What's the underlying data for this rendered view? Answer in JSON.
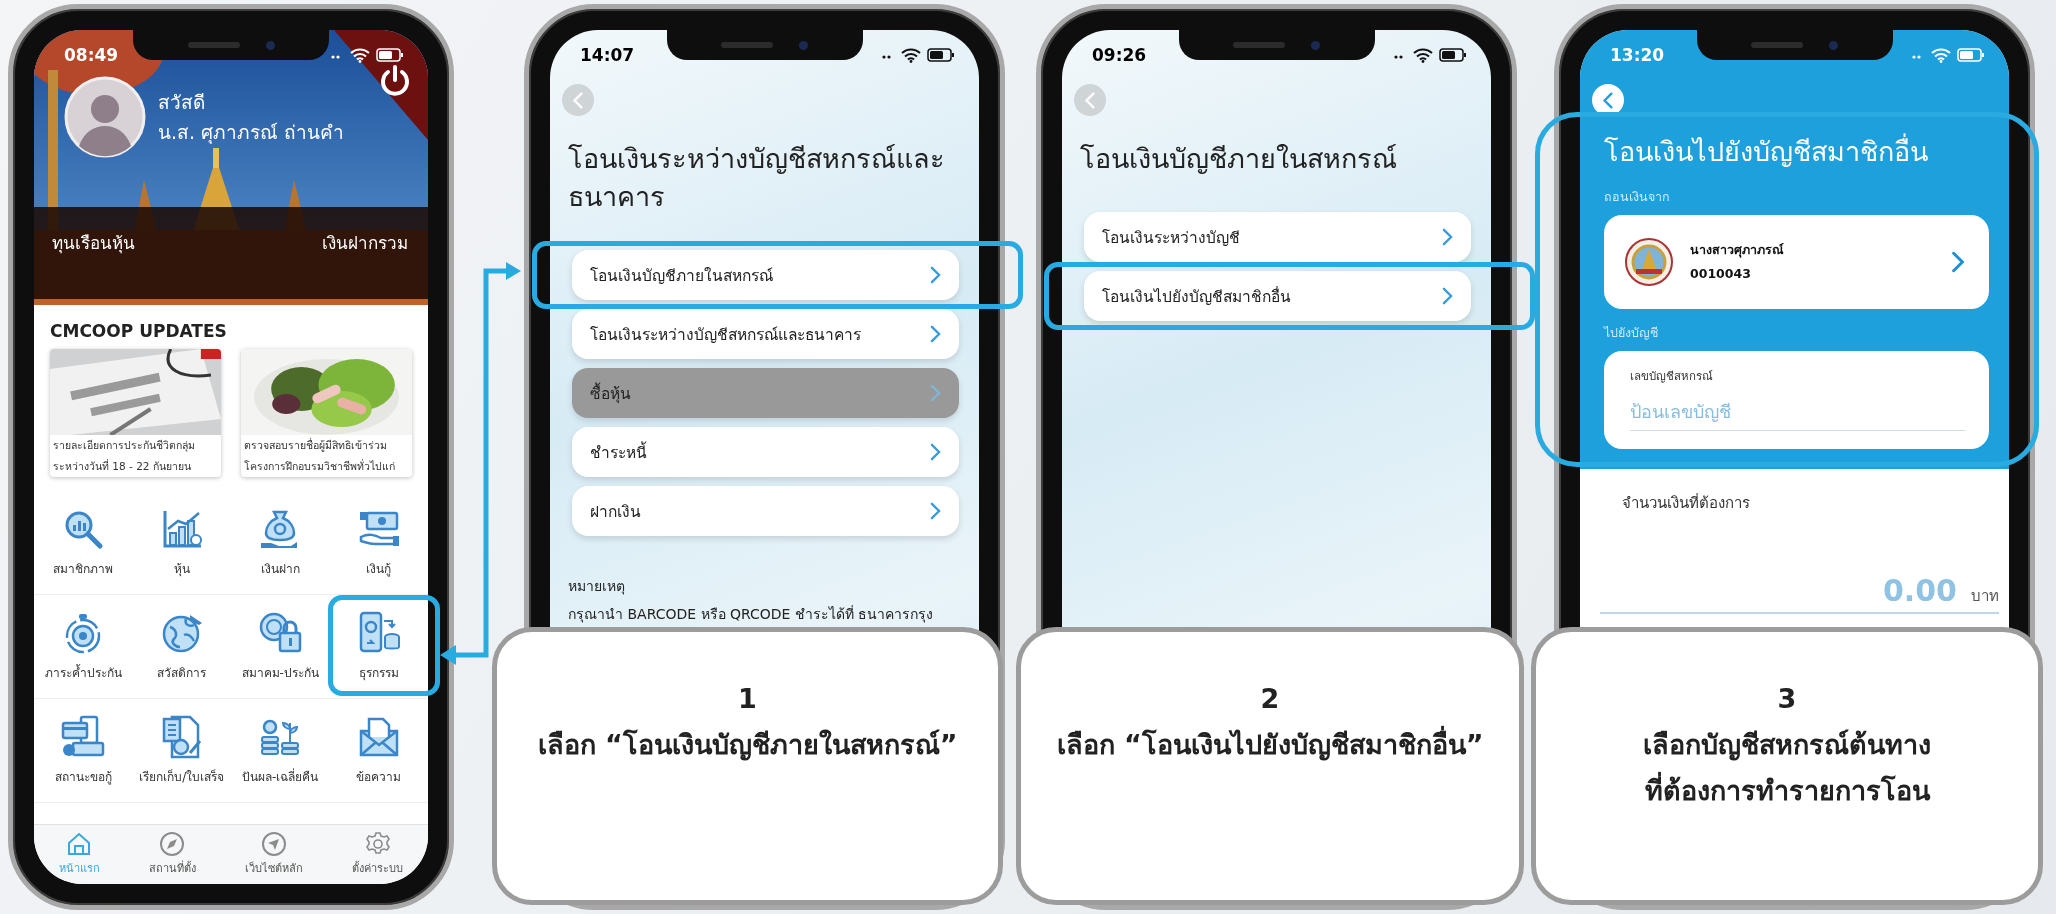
{
  "screens": [
    {
      "kind": "home",
      "time": "08:49",
      "greeting": "สวัสดี",
      "member_name": "น.ส. ศุภาภรณ์ ถ่านคำ",
      "balances": [
        "ทุนเรือนหุ้น",
        "เงินฝากรวม"
      ],
      "updates_title": "CMCOOP UPDATES",
      "news": [
        {
          "caption_lines": [
            "รายละเอียดการประกันชีวิตกลุ่ม",
            "ระหว่างวันที่ 18 - 22 กันยายน"
          ]
        },
        {
          "caption_lines": [
            "ตรวจสอบรายชื่อผู้มีสิทธิเข้าร่วม",
            "โครงการฝึกอบรมวิชาชีพทั่วไปแก่"
          ]
        }
      ],
      "menu": [
        {
          "label": "สมาชิกภาพ",
          "highlighted": false
        },
        {
          "label": "หุ้น",
          "highlighted": false
        },
        {
          "label": "เงินฝาก",
          "highlighted": false
        },
        {
          "label": "เงินกู้",
          "highlighted": false
        },
        {
          "label": "ภาระค้ำประกัน",
          "highlighted": false
        },
        {
          "label": "สวัสดิการ",
          "highlighted": false
        },
        {
          "label": "สมาคม-ประกัน",
          "highlighted": false
        },
        {
          "label": "ธุรกรรม",
          "highlighted": true
        },
        {
          "label": "สถานะขอกู้",
          "highlighted": false
        },
        {
          "label": "เรียกเก็บ/ใบเสร็จ",
          "highlighted": false
        },
        {
          "label": "ปันผล-เฉลี่ยคืน",
          "highlighted": false
        },
        {
          "label": "ข้อความ",
          "highlighted": false
        }
      ],
      "tabs": [
        {
          "label": "หน้าแรก",
          "selected": true
        },
        {
          "label": "สถานที่ตั้ง",
          "selected": false
        },
        {
          "label": "เว็บไซต์หลัก",
          "selected": false
        },
        {
          "label": "ตั้งค่าระบบ",
          "selected": false
        }
      ]
    },
    {
      "kind": "menu",
      "time": "14:07",
      "title_lines": [
        "โอนเงินระหว่างบัญชีสหกรณ์และ",
        "ธนาคาร"
      ],
      "options": [
        {
          "label": "โอนเงินบัญชีภายในสหกรณ์",
          "highlighted": true,
          "pressed": false
        },
        {
          "label": "โอนเงินระหว่างบัญชีสหกรณ์และธนาคาร",
          "highlighted": false,
          "pressed": false
        },
        {
          "label": "ซื้อหุ้น",
          "highlighted": false,
          "pressed": true
        },
        {
          "label": "ชำระหนี้",
          "highlighted": false,
          "pressed": false
        },
        {
          "label": "ฝากเงิน",
          "highlighted": false,
          "pressed": false
        }
      ],
      "note": {
        "title": "หมายเหตุ",
        "text": "กรุณานำ BARCODE หรือ QRCODE ชำระได้ที่ ธนาคารกรุง"
      }
    },
    {
      "kind": "menu",
      "time": "09:26",
      "title_lines": [
        "โอนเงินบัญชีภายในสหกรณ์"
      ],
      "options": [
        {
          "label": "โอนเงินระหว่างบัญชี",
          "highlighted": false,
          "pressed": false
        },
        {
          "label": "โอนเงินไปยังบัญชีสมาชิกอื่น",
          "highlighted": true,
          "pressed": false
        }
      ]
    },
    {
      "kind": "transfer",
      "time": "13:20",
      "title": "โอนเงินไปยังบัญชีสมาชิกอื่น",
      "highlighted": true,
      "from_label": "ถอนเงินจาก",
      "from_account": {
        "name": "นางสาวศุภาภรณ์",
        "number": "0010043"
      },
      "to_label": "ไปยังบัญชี",
      "account_field": {
        "label": "เลขบัญชีสหกรณ์",
        "placeholder": "ป้อนเลขบัญชี"
      },
      "amount_label": "จำนวนเงินที่ต้องการ",
      "amount": "0.00",
      "currency": "บาท"
    }
  ],
  "callouts": [
    {
      "number": "1",
      "lines": [
        "เลือก “โอนเงินบัญชีภายในสหกรณ์”"
      ]
    },
    {
      "number": "2",
      "lines": [
        "เลือก “โอนเงินไปยังบัญชีสมาชิกอื่น”"
      ]
    },
    {
      "number": "3",
      "lines": [
        "เลือกบัญชีสหกรณ์ต้นทาง",
        "ที่ต้องการทำรายการโอน"
      ]
    }
  ]
}
